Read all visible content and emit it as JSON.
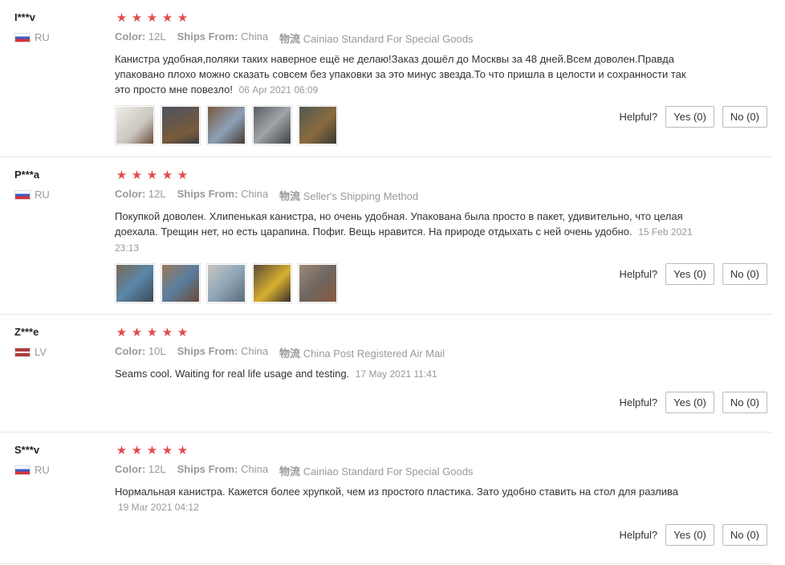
{
  "labels": {
    "color": "Color:",
    "ships_from": "Ships From:",
    "logistics": "物流",
    "helpful": "Helpful?"
  },
  "stars_glyph": "★",
  "reviews": [
    {
      "user": "I***v",
      "country": "RU",
      "color": "12L",
      "ships_from": "China",
      "shipping": "Cainiao Standard For Special Goods",
      "text": "Канистра удобная,поляки таких наверное ещё не делаю!Заказ дошёл до Москвы за 48 дней.Всем доволен.Правда упаковано плохо можно сказать совсем без упаковки за это минус звезда.То что пришла в целости и сохранности так это просто мне повезло!",
      "date": "06 Apr 2021 06:09",
      "yes": "Yes (0)",
      "no": "No (0)",
      "photos": [
        "#d9d6cf",
        "#5b6370",
        "#8d7a66",
        "#6f7478",
        "#7a6a50"
      ]
    },
    {
      "user": "P***a",
      "country": "RU",
      "color": "12L",
      "ships_from": "China",
      "shipping": "Seller's Shipping Method",
      "text": "Покупкой доволен. Хлипенькая канистра, но очень удобная. Упакована была просто в пакет, удивительно, что целая доехала. Трещин нет, но есть царапина. Пофиг. Вещь нравится. На природе отдыхать с ней очень удобно.",
      "date": "15 Feb 2021 23:13",
      "yes": "Yes (0)",
      "no": "No (0)",
      "photos": [
        "#5a86a8",
        "#8a6a4a",
        "#8fa6b8",
        "#9a7a30",
        "#6e6660"
      ]
    },
    {
      "user": "Z***e",
      "country": "LV",
      "color": "10L",
      "ships_from": "China",
      "shipping": "China Post Registered Air Mail",
      "text": "Seams cool. Waiting for real life usage and testing.",
      "date": "17 May 2021 11:41",
      "yes": "Yes (0)",
      "no": "No (0)",
      "photos": []
    },
    {
      "user": "S***v",
      "country": "RU",
      "color": "12L",
      "ships_from": "China",
      "shipping": "Cainiao Standard For Special Goods",
      "text": "Нормальная канистра. Кажется более хрупкой, чем из простого пластика. Зато удобно ставить на стол для разлива",
      "date": "19 Mar 2021 04:12",
      "yes": "Yes (0)",
      "no": "No (0)",
      "photos": []
    }
  ]
}
